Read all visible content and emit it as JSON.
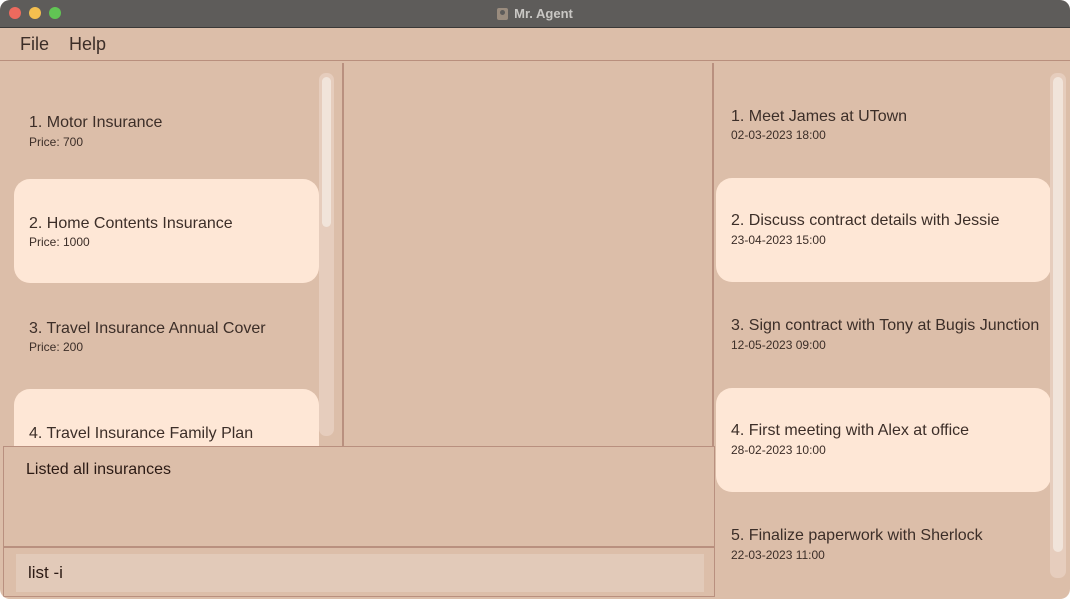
{
  "window": {
    "title": "Mr. Agent"
  },
  "menu": {
    "file": "File",
    "help": "Help"
  },
  "insurances": [
    {
      "title": "1.  Motor Insurance",
      "price": "Price: 700"
    },
    {
      "title": "2.  Home Contents Insurance",
      "price": "Price: 1000"
    },
    {
      "title": "3.  Travel Insurance Annual Cover",
      "price": "Price: 200"
    },
    {
      "title": "4.  Travel Insurance Family Plan",
      "price": ""
    }
  ],
  "meetings": [
    {
      "title": "1. Meet James at UTown",
      "datetime": "02-03-2023 18:00"
    },
    {
      "title": "2. Discuss contract details with Jessie",
      "datetime": "23-04-2023 15:00"
    },
    {
      "title": "3. Sign contract with Tony at Bugis Junction",
      "datetime": "12-05-2023 09:00"
    },
    {
      "title": "4. First meeting with Alex at office",
      "datetime": "28-02-2023 10:00"
    },
    {
      "title": "5. Finalize paperwork with Sherlock",
      "datetime": "22-03-2023 11:00"
    }
  ],
  "result": {
    "message": "Listed all insurances"
  },
  "command": {
    "value": "list -i"
  },
  "colors": {
    "window_bg": "#dcbea9",
    "card_highlight": "#fee7d6",
    "titlebar": "#5e5c5a",
    "border": "#b9907f",
    "text": "#3c2e28"
  }
}
